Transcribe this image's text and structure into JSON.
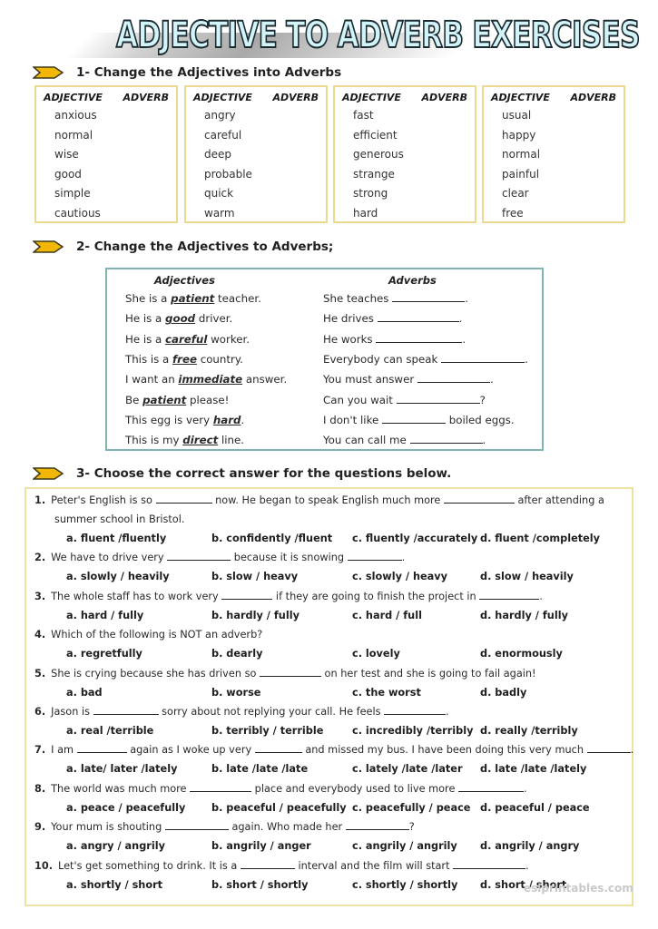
{
  "title": "ADJECTIVE TO ADVERB EXERCISES",
  "section1": {
    "heading": "1- Change the Adjectives into Adverbs",
    "icon": "chevron-arrow-icon",
    "col_adjective": "ADJECTIVE",
    "col_adverb": "ADVERB",
    "boxes": [
      {
        "words": [
          "anxious",
          "normal",
          "wise",
          "good",
          "simple",
          "cautious"
        ]
      },
      {
        "words": [
          "angry",
          "careful",
          "deep",
          "probable",
          "quick",
          "warm"
        ]
      },
      {
        "words": [
          "fast",
          "efficient",
          "generous",
          "strange",
          "strong",
          "hard"
        ]
      },
      {
        "words": [
          "usual",
          "happy",
          "normal",
          "painful",
          "clear",
          "free"
        ]
      }
    ]
  },
  "section2": {
    "heading": "2- Change the Adjectives to Adverbs;",
    "col_adjectives": "Adjectives",
    "col_adverbs": "Adverbs",
    "rows": [
      {
        "adj_pre": "She is a ",
        "adj_word": "patient",
        "adj_post": " teacher.",
        "adv_pre": "She teaches ",
        "adv_post": "."
      },
      {
        "adj_pre": "He is a ",
        "adj_word": "good",
        "adj_post": " driver.",
        "adv_pre": "He drives ",
        "adv_post": "."
      },
      {
        "adj_pre": "He is a ",
        "adj_word": "careful",
        "adj_post": " worker.",
        "adv_pre": "He works ",
        "adv_post": "."
      },
      {
        "adj_pre": "This is a ",
        "adj_word": "free",
        "adj_post": " country.",
        "adv_pre": "Everybody can speak ",
        "adv_post": "."
      },
      {
        "adj_pre": "I want an ",
        "adj_word": "immediate",
        "adj_post": " answer.",
        "adv_pre": "You must answer ",
        "adv_post": "."
      },
      {
        "adj_pre": "Be ",
        "adj_word": "patient",
        "adj_post": " please!",
        "adv_pre": "Can you wait ",
        "adv_post": "?"
      },
      {
        "adj_pre": "This egg is very ",
        "adj_word": "hard",
        "adj_post": ".",
        "adv_pre": "I don't like ",
        "adv_post": " boiled eggs."
      },
      {
        "adj_pre": "This is my ",
        "adj_word": "direct",
        "adj_post": " line.",
        "adv_pre": "You can call me ",
        "adv_post": "."
      }
    ]
  },
  "section3": {
    "heading": "3- Choose the correct answer for the questions below.",
    "questions": [
      {
        "num": "1.",
        "parts": [
          "Peter's English is so ",
          " now. He began to speak English much more ",
          " after attending a"
        ],
        "line2": "summer school in Bristol.",
        "options": [
          "a. fluent /fluently",
          "b. confidently /fluent",
          "c. fluently /accurately",
          "d. fluent /completely"
        ]
      },
      {
        "num": "2.",
        "parts": [
          "We have to drive very ",
          " because it is snowing ",
          "."
        ],
        "options": [
          "a. slowly / heavily",
          "b. slow / heavy",
          "c. slowly / heavy",
          "d. slow / heavily"
        ]
      },
      {
        "num": "3.",
        "parts": [
          "The whole staff has to work very ",
          " if they are going to finish the project in ",
          "."
        ],
        "options": [
          "a. hard / fully",
          "b. hardly / fully",
          "c. hard / full",
          "d. hardly / fully"
        ]
      },
      {
        "num": "4.",
        "parts": [
          "Which of the following is NOT an adverb?"
        ],
        "options": [
          "a. regretfully",
          "b. dearly",
          "c. lovely",
          "d. enormously"
        ]
      },
      {
        "num": "5.",
        "parts": [
          "She is crying because she has driven so ",
          " on her test and she is going to fail again!"
        ],
        "options": [
          "a. bad",
          "b. worse",
          "c. the worst",
          "d. badly"
        ]
      },
      {
        "num": "6.",
        "parts": [
          "Jason is ",
          " sorry about not replying your call. He feels ",
          "."
        ],
        "options": [
          "a. real /terrible",
          "b. terribly / terrible",
          "c. incredibly /terribly",
          "d. really /terribly"
        ]
      },
      {
        "num": "7.",
        "parts": [
          "I am ",
          " again as I woke up very ",
          " and missed my bus. I have been doing this very much ",
          "."
        ],
        "options": [
          "a. late/ later /lately",
          "b. late /late /late",
          "c. lately /late /later",
          "d. late /late /lately"
        ]
      },
      {
        "num": "8.",
        "parts": [
          "The world was much more ",
          " place and everybody used to live more ",
          "."
        ],
        "options": [
          "a. peace / peacefully",
          "b. peaceful / peacefully",
          "c. peacefully / peace",
          "d. peaceful / peace"
        ]
      },
      {
        "num": "9.",
        "parts": [
          "Your mum is shouting ",
          " again. Who made her ",
          "?"
        ],
        "options": [
          "a. angry / angrily",
          "b. angrily / anger",
          "c. angrily / angrily",
          "d. angrily / angry"
        ]
      },
      {
        "num": "10.",
        "parts": [
          "Let's get something to drink. It is a ",
          " interval and the film will start ",
          "."
        ],
        "options": [
          "a. shortly / short",
          "b. short / shortly",
          "c. shortly / shortly",
          "d. short / short"
        ]
      }
    ]
  },
  "watermark": "eslprintables.com",
  "colors": {
    "arrow_fill": "#f2b705",
    "arrow_stroke": "#3a3a1a",
    "box1_border": "#ead98e",
    "box2_border": "#7fb3b5",
    "box3_border": "#ece3a1",
    "title_fill": "#d2f4f9"
  }
}
